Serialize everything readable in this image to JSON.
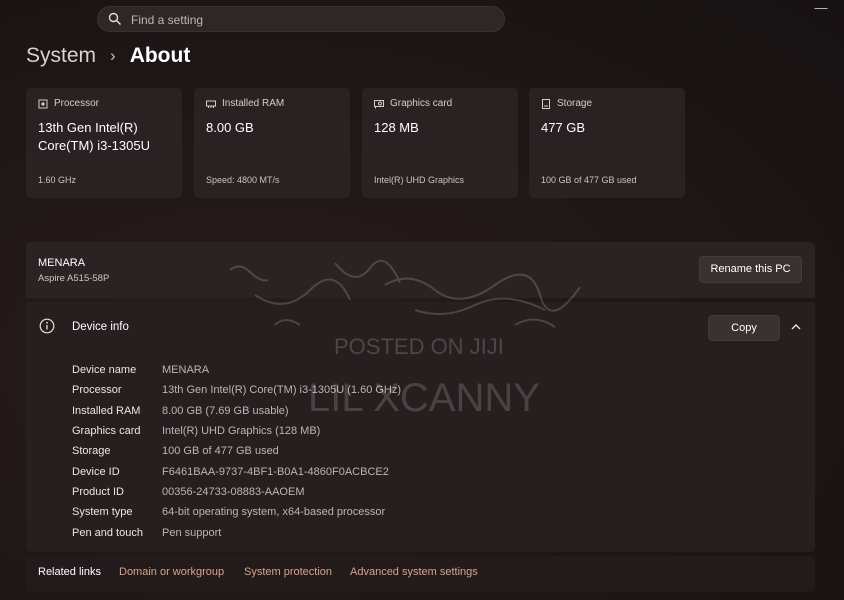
{
  "search": {
    "placeholder": "Find a setting"
  },
  "breadcrumb": {
    "parent": "System",
    "separator": "›",
    "current": "About"
  },
  "cards": [
    {
      "icon": "processor-icon",
      "label": "Processor",
      "value": "13th Gen Intel(R) Core(TM) i3-1305U",
      "sub": "1.60 GHz"
    },
    {
      "icon": "ram-icon",
      "label": "Installed RAM",
      "value": "8.00 GB",
      "sub": "Speed: 4800 MT/s"
    },
    {
      "icon": "graphics-card-icon",
      "label": "Graphics card",
      "value": "128 MB",
      "sub": "Intel(R) UHD Graphics"
    },
    {
      "icon": "storage-icon",
      "label": "Storage",
      "value": "477 GB",
      "sub": "100 GB of 477 GB used"
    }
  ],
  "pc": {
    "name": "MENARA",
    "model": "Aspire A515-58P",
    "rename_label": "Rename this PC"
  },
  "device_info": {
    "title": "Device info",
    "copy_label": "Copy",
    "rows": [
      {
        "label": "Device name",
        "value": "MENARA"
      },
      {
        "label": "Processor",
        "value": "13th Gen Intel(R) Core(TM) i3-1305U (1.60 GHz)"
      },
      {
        "label": "Installed RAM",
        "value": "8.00 GB (7.69 GB usable)"
      },
      {
        "label": "Graphics card",
        "value": "Intel(R) UHD Graphics (128 MB)"
      },
      {
        "label": "Storage",
        "value": "100 GB of 477 GB used"
      },
      {
        "label": "Device ID",
        "value": "F6461BAA-9737-4BF1-B0A1-4860F0ACBCE2"
      },
      {
        "label": "Product ID",
        "value": "00356-24733-08883-AAOEM"
      },
      {
        "label": "System type",
        "value": "64-bit operating system, x64-based processor"
      },
      {
        "label": "Pen and touch",
        "value": "Pen support"
      }
    ]
  },
  "related_links": {
    "label": "Related links",
    "links": [
      "Domain or workgroup",
      "System protection",
      "Advanced system settings"
    ]
  },
  "watermark": {
    "line1": "POSTED ON JIJI",
    "line2": "LIL XCANNY"
  },
  "window_controls": {
    "minimize_glyph": "—"
  },
  "colors": {
    "background": "#1e1616",
    "card": "#2a2222",
    "link": "#d9a58a"
  }
}
